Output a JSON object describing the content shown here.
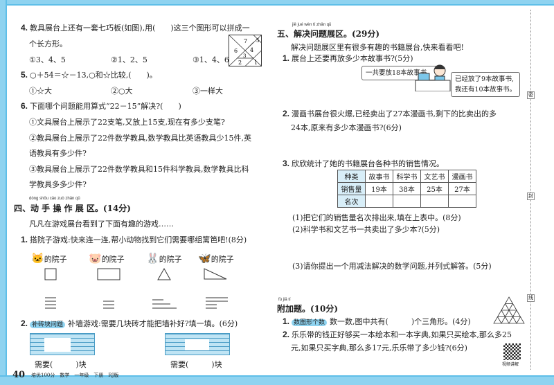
{
  "left": {
    "q4": {
      "num": "4.",
      "text": "教具展台上还有一套七巧板(如图),用(　　)这三个图形可以拼成一",
      "text2": "个长方形。",
      "options": [
        "①3、4、5",
        "②1、2、5",
        "③1、4、6"
      ],
      "tangram_labels": [
        "7",
        "5",
        "6",
        "4",
        "3",
        "2",
        "1"
      ]
    },
    "q5": {
      "num": "5.",
      "text": "○＋54＝☆－13,○和☆比较,(　　)。",
      "options": [
        "①☆大",
        "②○大",
        "③一样大"
      ]
    },
    "q6": {
      "num": "6.",
      "text": "下面哪个问题能用算式“22－15”解决?(　　)",
      "o1": "①文具展台上展示了22支笔,又放上15支,现在有多少支笔?",
      "o2a": "②教具展台上展示了22件数学教具,数学教具比英语教具少15件,英",
      "o2b": "语教具有多少件?",
      "o3a": "③教具展台上展示了22件数学教具和15件科学教具,数学教具比科",
      "o3b": "学教具多多少件?"
    },
    "sec4": {
      "pinyin": "dòng shǒu cāo zuò zhǎn qū",
      "title": "四、动 手 操 作 展 区。(14分)",
      "intro": "凡凡在游戏展台看到了下面有趣的游戏……",
      "q1": {
        "num": "1.",
        "text": "搭院子游戏:快来连一连,帮小动物找到它们需要哪组篱笆吧!(8分)",
        "yard_label": "的院子"
      },
      "q2": {
        "num": "2.",
        "tag": "补砖块问题",
        "text": "补墙游戏:需要几块砖才能把墙补好?填一填。(6分)",
        "need": "需要(　　　)块"
      }
    },
    "footer": {
      "page": "40",
      "text": "培优100分　数学　一年级　下册　RJ版"
    }
  },
  "right": {
    "sec5": {
      "pinyin": "jiě jué wèn tí zhǎn qū",
      "title": "五、解决问题展区。(29分)",
      "intro": "解决问题展区里有很多有趣的书籍展台,快来看看吧!",
      "q1": {
        "num": "1.",
        "text": "展台上还要再放多少本故事书?(5分)",
        "bubble1": "一共要放18本故事书。",
        "bubble2a": "已经放了9本故事书,",
        "bubble2b": "我还有10本故事书。"
      },
      "q2": {
        "num": "2.",
        "text": "漫画书展台很火爆,已经卖出了27本漫画书,剩下的比卖出的多",
        "text2": "24本,原来有多少本漫画书?(6分)"
      },
      "q3": {
        "num": "3.",
        "text": "欣欣统计了她的书籍展台各种书的销售情况。",
        "table": {
          "rows": [
            [
              "种类",
              "故事书",
              "科学书",
              "文艺书",
              "漫画书"
            ],
            [
              "销售量",
              "19本",
              "38本",
              "25本",
              "27本"
            ],
            [
              "名次",
              "",
              "",
              "",
              ""
            ]
          ]
        },
        "s1": "(1)把它们的销售量名次排出来,填在上表中。(8分)",
        "s2": "(2)科学书和文艺书一共卖出了多少本?(5分)",
        "s3": "(3)请你提出一个用减法解决的数学问题,并列式解答。(5分)"
      }
    },
    "extra": {
      "pinyin": "fù jiā tí",
      "title": "附加题。(10分)",
      "q1": {
        "num": "1.",
        "tag": "数图形个数",
        "text": "数一数,图中共有(　　　)个三角形。(4分)"
      },
      "q2": {
        "num": "2.",
        "text": "乐乐带的钱正好够买一本绘本和一本字典,如果只买绘本,那么多25",
        "text2": "元,如果只买字典,那么多17元,乐乐带了多少钱?(6分)"
      },
      "qr_label": "视频讲解"
    },
    "side_marks": [
      "密",
      "封",
      "线"
    ]
  }
}
